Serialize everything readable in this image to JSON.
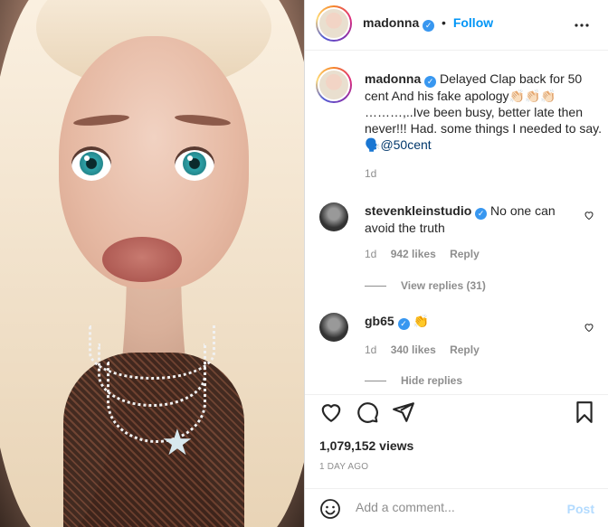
{
  "post": {
    "username": "madonna",
    "follow_label": "Follow",
    "separator": "•",
    "caption_username": "madonna",
    "caption_text": "Delayed Clap back for 50 cent And his fake apology👏🏻👏🏻👏🏻 ………,..Ive been busy, better late then never!!! Had. some things I needed to say. 🗣️",
    "caption_mention": "@50cent",
    "caption_time": "1d"
  },
  "comments": [
    {
      "username": "stevenkleinstudio",
      "text": "No one can avoid the truth",
      "time": "1d",
      "likes": "942 likes",
      "reply_label": "Reply",
      "view_replies": "View replies (31)"
    },
    {
      "username": "gb65",
      "text": "👏",
      "time": "1d",
      "likes": "340 likes",
      "reply_label": "Reply",
      "view_replies": "Hide replies"
    }
  ],
  "footer": {
    "views": "1,079,152 views",
    "ago": "1 DAY AGO",
    "comment_placeholder": "Add a comment...",
    "post_label": "Post"
  },
  "icons": {
    "more": "more-horizontal-icon",
    "like": "heart-icon",
    "comment": "comment-bubble-icon",
    "share": "paper-plane-icon",
    "save": "bookmark-icon",
    "emoji": "emoji-smile-icon"
  },
  "colors": {
    "accent": "#0095f6",
    "verified": "#3897f0",
    "text": "#262626",
    "muted": "#8e8e8e",
    "link": "#00376b"
  }
}
